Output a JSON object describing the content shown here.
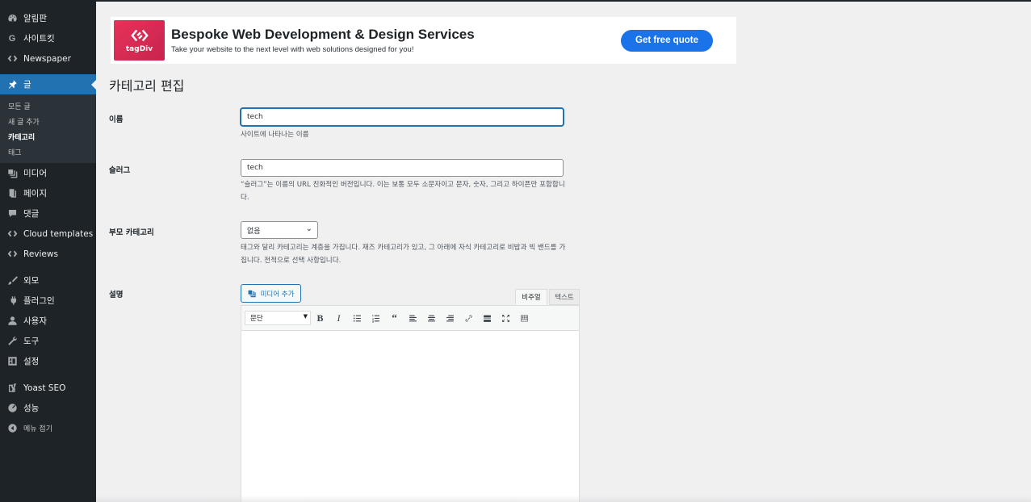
{
  "sidebar": {
    "items": [
      {
        "label": "알림판",
        "icon": "dashboard-icon"
      },
      {
        "label": "사이트킷",
        "icon": "sitekit-icon"
      },
      {
        "label": "Newspaper",
        "icon": "tagdiv-icon"
      },
      {
        "label": "글",
        "icon": "pin-icon"
      },
      {
        "label": "미디어",
        "icon": "media-icon"
      },
      {
        "label": "페이지",
        "icon": "page-icon"
      },
      {
        "label": "댓글",
        "icon": "comment-icon"
      },
      {
        "label": "Cloud templates",
        "icon": "tagdiv-icon"
      },
      {
        "label": "Reviews",
        "icon": "tagdiv-icon"
      },
      {
        "label": "외모",
        "icon": "brush-icon"
      },
      {
        "label": "플러그인",
        "icon": "plugin-icon"
      },
      {
        "label": "사용자",
        "icon": "user-icon"
      },
      {
        "label": "도구",
        "icon": "wrench-icon"
      },
      {
        "label": "설정",
        "icon": "settings-icon"
      },
      {
        "label": "Yoast SEO",
        "icon": "yoast-icon"
      },
      {
        "label": "성능",
        "icon": "performance-icon"
      }
    ],
    "submenu": [
      "모든 글",
      "새 글 추가",
      "카테고리",
      "태그"
    ],
    "collapse_label": "메뉴 접기"
  },
  "banner": {
    "logo_text": "tagDiv",
    "title": "Bespoke Web Development & Design Services",
    "subtitle": "Take your website to the next level with web solutions designed for you!",
    "button": "Get free quote"
  },
  "page": {
    "title": "카테고리 편집",
    "name_label": "이름",
    "name_value": "tech",
    "name_desc": "사이트에 나타나는 이름",
    "slug_label": "슬러그",
    "slug_value": "tech",
    "slug_desc": "“슬러그”는 이름의 URL 친화적인 버전입니다. 이는 보통 모두 소문자이고 문자, 숫자, 그리고 하이픈만 포함합니다.",
    "parent_label": "부모 카테고리",
    "parent_value": "없음",
    "parent_desc": "태그와 달리 카테고리는 계층을 가집니다. 재즈 카테고리가 있고, 그 아래에 자식 카테고리로 비밥과 빅 밴드를 가집니다. 전적으로 선택 사항입니다.",
    "desc_label": "설명",
    "media_button": "미디어 추가",
    "tab_visual": "비주얼",
    "tab_text": "텍스트",
    "format_value": "문단"
  },
  "colors": {
    "sidebar_bg": "#1d2327",
    "active": "#2271b1",
    "banner_button": "#1a73e8",
    "logo": "#e6335a"
  }
}
